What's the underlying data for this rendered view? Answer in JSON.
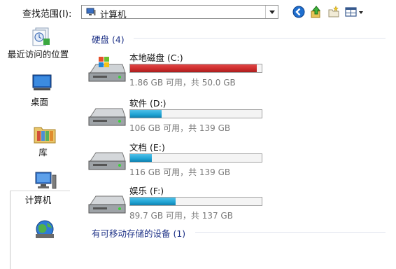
{
  "toolbar": {
    "look_in_label": "查找范围(I):",
    "location": "计算机",
    "icons": [
      "back-icon",
      "up-folder-icon",
      "new-folder-icon",
      "view-menu-icon"
    ]
  },
  "places": [
    {
      "label": "最近访问的位置",
      "icon": "recent-places-icon"
    },
    {
      "label": "桌面",
      "icon": "desktop-icon"
    },
    {
      "label": "库",
      "icon": "libraries-icon"
    },
    {
      "label": "计算机",
      "icon": "computer-icon",
      "selected": true
    },
    {
      "label": "",
      "icon": "network-icon"
    }
  ],
  "groups": {
    "hard_disks": "硬盘 (4)",
    "removable": "有可移动存储的设备 (1)"
  },
  "drives": [
    {
      "name": "本地磁盘 (C:)",
      "free_text": "1.86 GB 可用，共 50.0 GB",
      "used_fraction": 0.963,
      "bar_color": "#cc2a2a",
      "system": true
    },
    {
      "name": "软件 (D:)",
      "free_text": "106 GB 可用，共 139 GB",
      "used_fraction": 0.237,
      "bar_color": "#1fa3d3",
      "system": false
    },
    {
      "name": "文档 (E:)",
      "free_text": "116 GB 可用，共 139 GB",
      "used_fraction": 0.165,
      "bar_color": "#1fa3d3",
      "system": false
    },
    {
      "name": "娱乐 (F:)",
      "free_text": "89.7 GB 可用，共 137 GB",
      "used_fraction": 0.345,
      "bar_color": "#1fa3d3",
      "system": false
    }
  ]
}
